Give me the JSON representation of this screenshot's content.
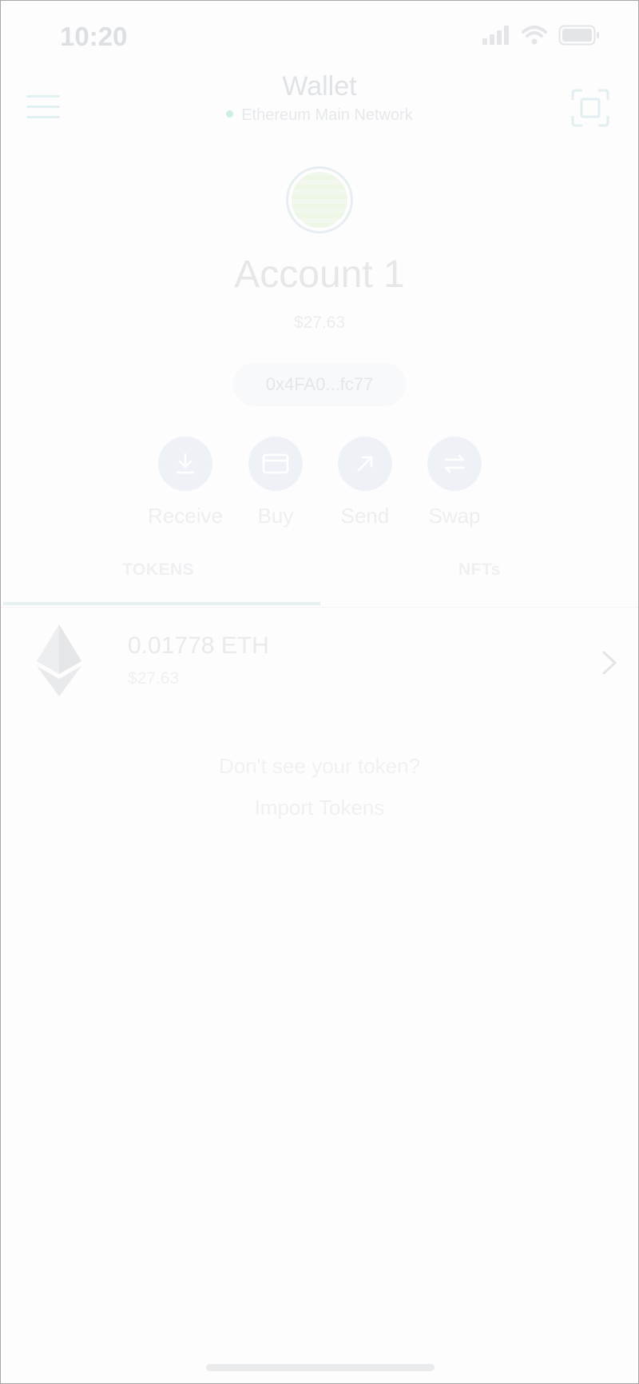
{
  "status": {
    "time": "10:20"
  },
  "header": {
    "title": "Wallet",
    "network": "Ethereum Main Network"
  },
  "account": {
    "name": "Account 1",
    "balance": "$27.63",
    "address": "0x4FA0...fc77"
  },
  "actions": [
    {
      "label": "Receive",
      "icon": "download-icon"
    },
    {
      "label": "Buy",
      "icon": "card-icon"
    },
    {
      "label": "Send",
      "icon": "arrow-up-right-icon"
    },
    {
      "label": "Swap",
      "icon": "swap-icon"
    }
  ],
  "tabs": [
    {
      "label": "TOKENS",
      "active": true
    },
    {
      "label": "NFTs",
      "active": false
    }
  ],
  "tokens": [
    {
      "amount": "0.01778 ETH",
      "value": "$27.63",
      "icon": "ethereum-icon"
    }
  ],
  "footer": {
    "hint": "Don't see your token?",
    "import_label": "Import Tokens"
  }
}
